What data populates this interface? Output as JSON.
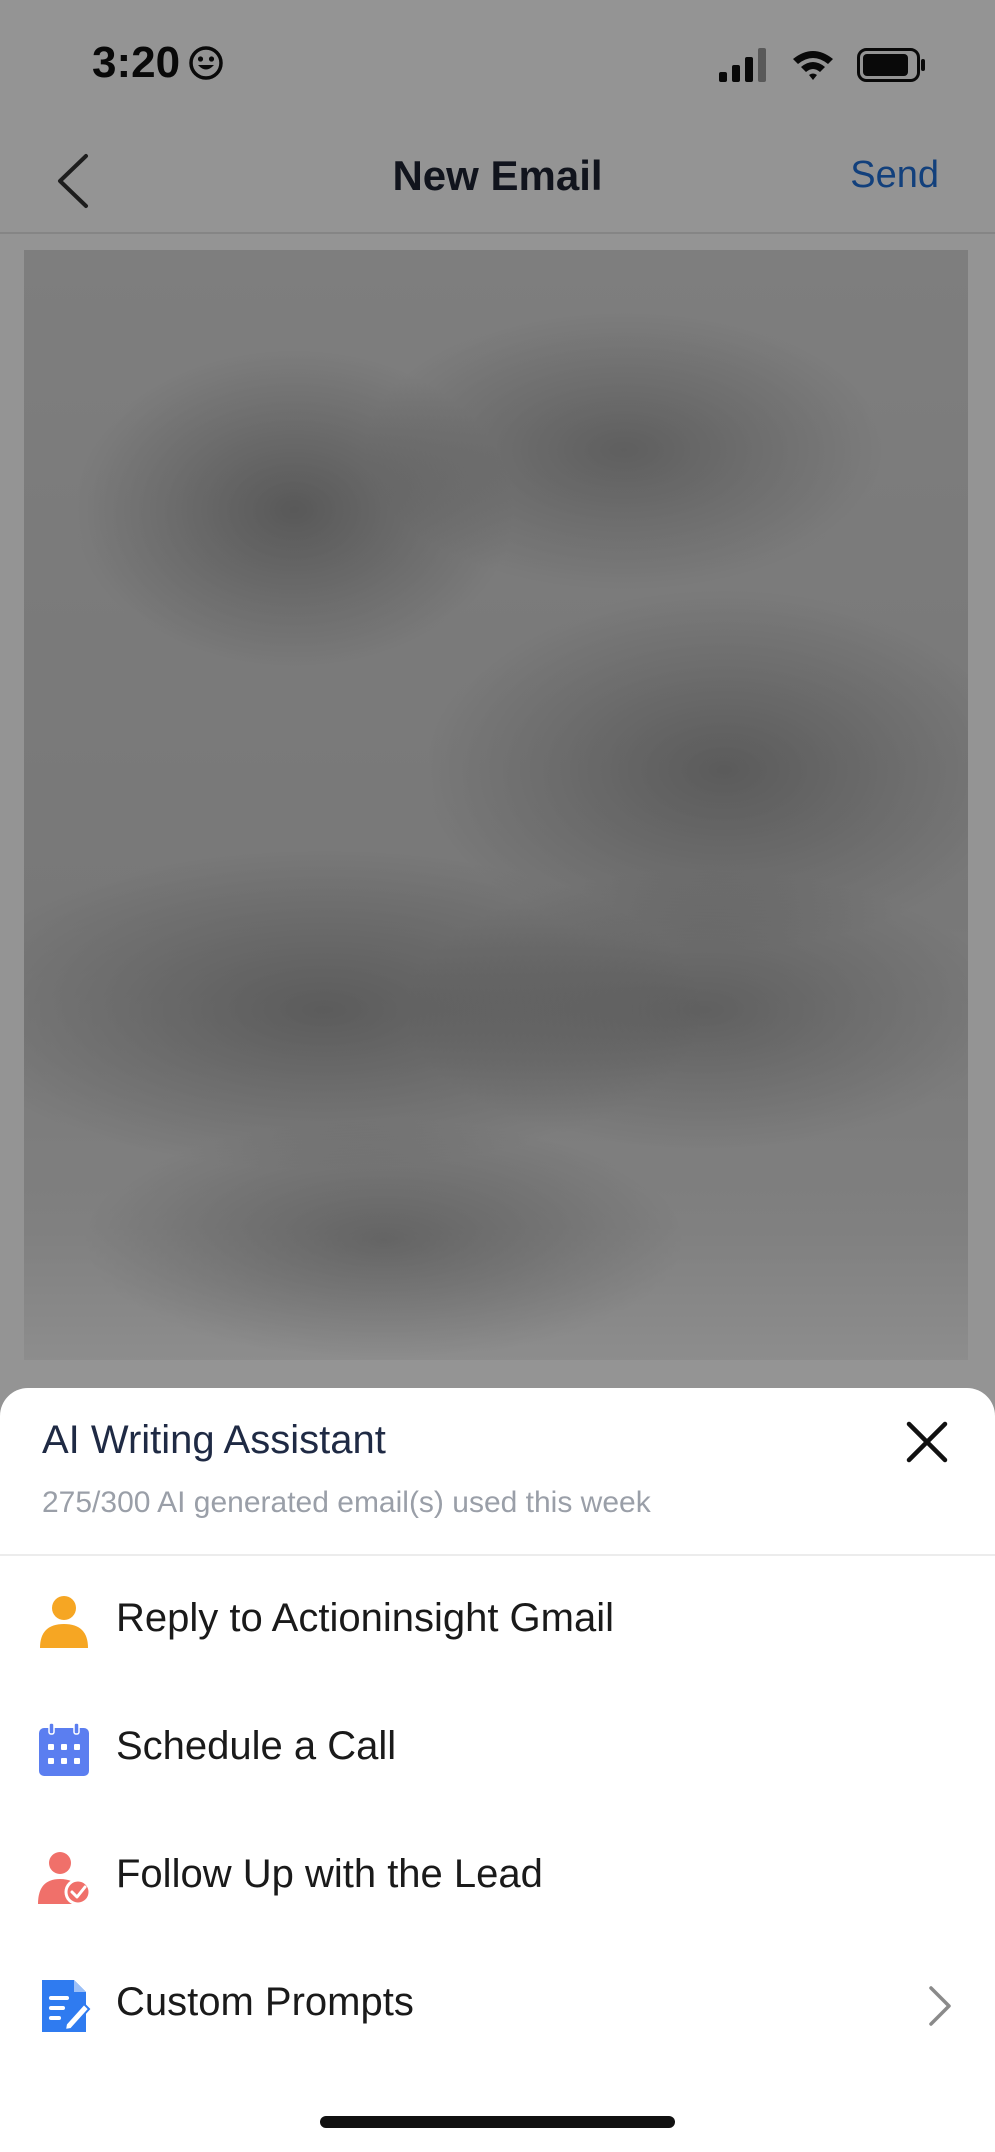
{
  "status_bar": {
    "time": "3:20",
    "icons": [
      "smiley-icon",
      "signal-icon",
      "wifi-icon",
      "battery-icon"
    ]
  },
  "nav": {
    "title": "New Email",
    "send_label": "Send",
    "back_icon": "chevron-left-icon"
  },
  "sheet": {
    "title": "AI Writing Assistant",
    "subtitle": "275/300 AI generated email(s) used this week",
    "close_icon": "close-icon",
    "options": [
      {
        "label": "Reply to Actioninsight Gmail",
        "icon": "person-icon"
      },
      {
        "label": "Schedule a Call",
        "icon": "calendar-icon"
      },
      {
        "label": "Follow Up with the Lead",
        "icon": "person-check-icon"
      },
      {
        "label": "Custom Prompts",
        "icon": "document-edit-icon",
        "has_chevron": true
      }
    ]
  },
  "colors": {
    "accent_blue": "#1f6fd6",
    "person_orange": "#f6a623",
    "calendar_blue": "#5b7ef0",
    "lead_coral": "#f0706a",
    "prompt_blue": "#2f7bf0"
  }
}
